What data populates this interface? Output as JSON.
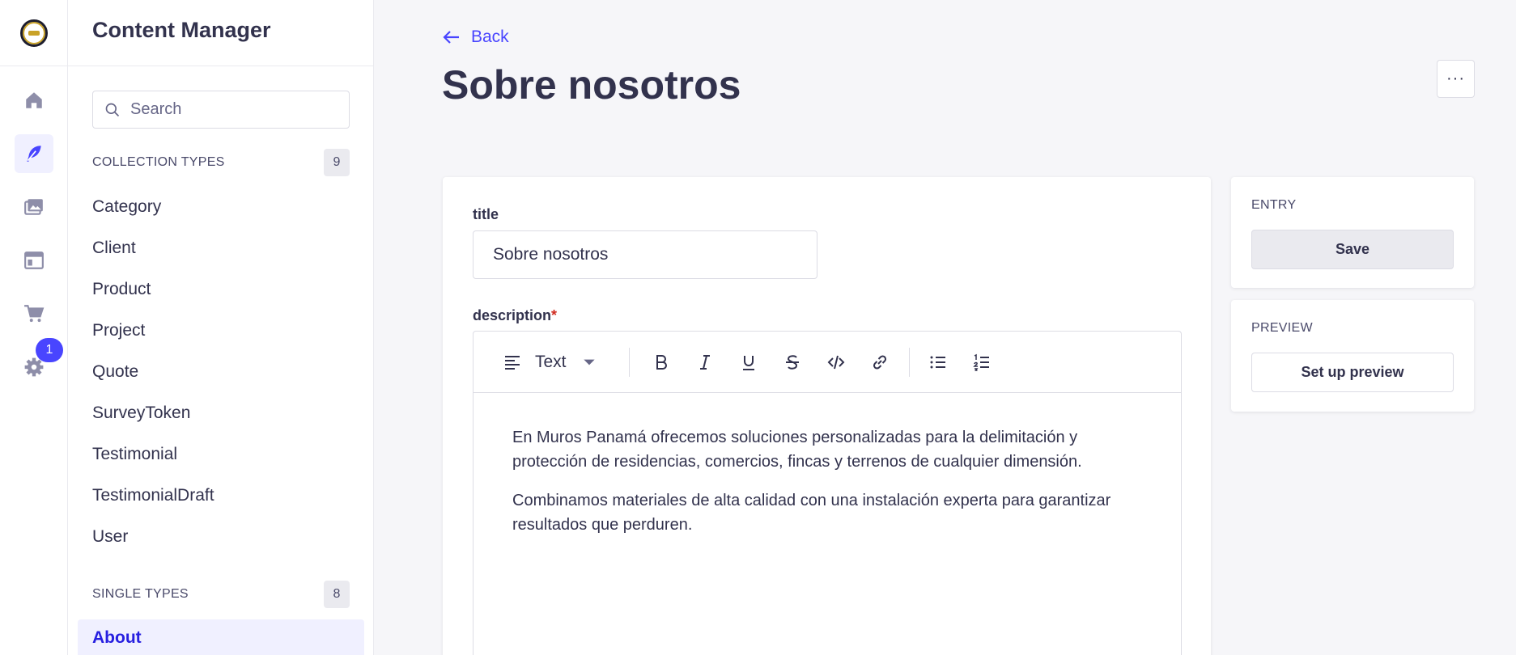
{
  "rail": {
    "badge_count": "1",
    "items": [
      {
        "icon": "home-icon"
      },
      {
        "icon": "feather-icon",
        "active": true
      },
      {
        "icon": "media-library-icon"
      },
      {
        "icon": "layout-icon"
      },
      {
        "icon": "cart-icon"
      },
      {
        "icon": "gear-icon"
      }
    ]
  },
  "sidebar": {
    "title": "Content Manager",
    "search_placeholder": "Search",
    "collection_label": "COLLECTION TYPES",
    "collection_count": "9",
    "collection_items": [
      "Category",
      "Client",
      "Product",
      "Project",
      "Quote",
      "SurveyToken",
      "Testimonial",
      "TestimonialDraft",
      "User"
    ],
    "single_label": "SINGLE TYPES",
    "single_count": "8",
    "single_items": [
      "About"
    ]
  },
  "header": {
    "back_label": "Back",
    "title": "Sobre nosotros",
    "more_label": "···"
  },
  "form": {
    "title_label": "title",
    "title_value": "Sobre nosotros",
    "description_label": "description",
    "required_mark": "*",
    "toolbar": {
      "block_type": "Text"
    },
    "paragraphs": [
      "En Muros Panamá ofrecemos soluciones personalizadas para la delimitación y protección de residencias,  comercios, fincas y terrenos de cualquier dimensión.",
      "Combinamos materiales de alta calidad con una instalación experta para garantizar resultados que perduren."
    ]
  },
  "entry_panel": {
    "label": "ENTRY",
    "save_label": "Save"
  },
  "preview_panel": {
    "label": "PREVIEW",
    "button_label": "Set up preview"
  },
  "colors": {
    "accent": "#4945ff",
    "text": "#32324d",
    "background": "#f6f6f9"
  }
}
